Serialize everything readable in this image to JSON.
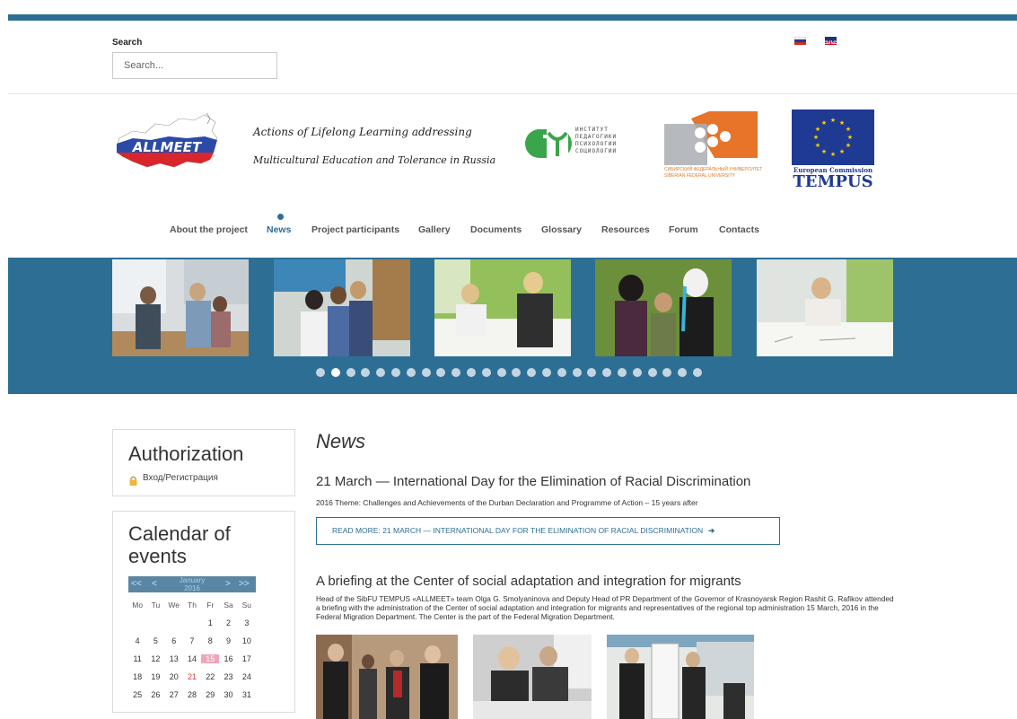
{
  "header": {
    "search_label": "Search",
    "search_placeholder": "Search...",
    "languages": [
      "ru-flag-icon",
      "en-flag-icon"
    ]
  },
  "branding": {
    "logo_text": "ALLMEET",
    "tagline_line1": "Actions of Lifelong Learning addressing",
    "tagline_line2": "Multicultural Education and Tolerance in Russia",
    "institute_text": [
      "ИНСТИТУТ",
      "ПЕДАГОГИКИ",
      "ПСИХОЛОГИИ",
      "СОЦИОЛОГИИ"
    ],
    "sfu_text": "СИБИРСКИЙ ФЕДЕРАЛЬНЫЙ УНИВЕРСИТЕТ SIBERIAN FEDERAL UNIVERSITY",
    "tempus_sub": "European Commission",
    "tempus_main": "TEMPUS"
  },
  "nav": {
    "items": [
      {
        "label": "About the project"
      },
      {
        "label": "News"
      },
      {
        "label": "Project participants"
      },
      {
        "label": "Gallery"
      },
      {
        "label": "Documents"
      },
      {
        "label": "Glossary"
      },
      {
        "label": "Resources"
      },
      {
        "label": "Forum"
      },
      {
        "label": "Contacts"
      }
    ],
    "active": "News"
  },
  "slider": {
    "slide_count": 5,
    "dot_count": 26,
    "active_dot": 2
  },
  "colors": {
    "brand": "#2d6f94",
    "calendar_header": "#5a86a3",
    "today": "#f0a6b8"
  },
  "auth": {
    "title": "Authorization",
    "link": "Вход/Регистрация"
  },
  "calendar": {
    "title": "Calendar of events",
    "prev_year": "<<",
    "prev_month": "<",
    "next_month": ">",
    "next_year": ">>",
    "month": "January",
    "year": "2016",
    "weekdays": [
      "Mo",
      "Tu",
      "We",
      "Th",
      "Fr",
      "Sa",
      "Su"
    ],
    "weeks": [
      [
        "",
        "",
        "",
        "",
        "1",
        "2",
        "3"
      ],
      [
        "4",
        "5",
        "6",
        "7",
        "8",
        "9",
        "10"
      ],
      [
        "11",
        "12",
        "13",
        "14",
        "15",
        "16",
        "17"
      ],
      [
        "18",
        "19",
        "20",
        "21",
        "22",
        "23",
        "24"
      ],
      [
        "25",
        "26",
        "27",
        "28",
        "29",
        "30",
        "31"
      ]
    ],
    "today": "15",
    "highlighted": "21"
  },
  "news": {
    "heading": "News",
    "articles": [
      {
        "title": "21 March — International Day for the Elimination of Racial Discrimination",
        "subtitle": "2016 Theme: Challenges and Achievements of the Durban Declaration and Programme of Action – 15 years after",
        "read_more": "READ MORE: 21 MARCH — INTERNATIONAL DAY FOR THE ELIMINATION OF RACIAL DISCRIMINATION"
      },
      {
        "title": "A briefing at the Center of social adaptation and integration for migrants",
        "body": "Head of the SibFU TEMPUS «ALLMEET» team  Olga G. Smolyaninova and Deputy Head of PR Department of the Governor of Krasnoyarsk Region Rashit G. Rafikov attended a briefing with the administration of the Center of social adaptation and integration for migrants and representatives of the regional top administration 15 March, 2016 in the Federal Migration Department. The Center is the part of the Federal Migration Department."
      }
    ]
  }
}
